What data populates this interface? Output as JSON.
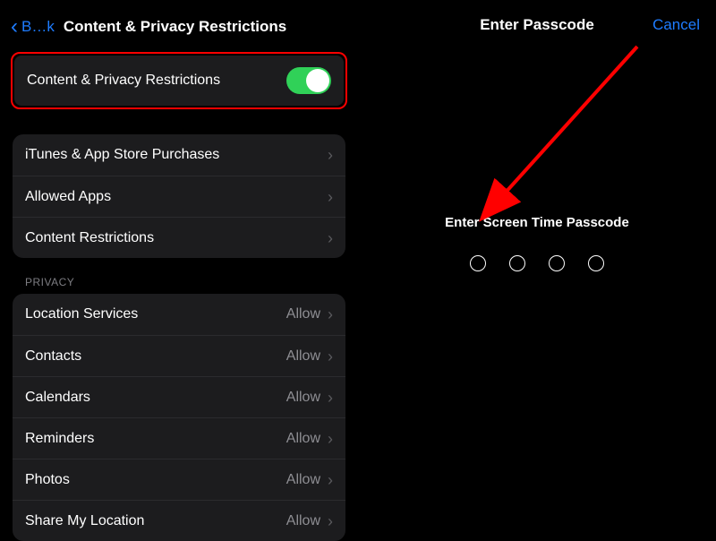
{
  "left": {
    "back_text": "B…k",
    "title": "Content & Privacy Restrictions",
    "toggle_row": {
      "label": "Content & Privacy Restrictions",
      "on": true
    },
    "nav_group": [
      {
        "label": "iTunes & App Store Purchases"
      },
      {
        "label": "Allowed Apps"
      },
      {
        "label": "Content Restrictions"
      }
    ],
    "privacy_header": "Privacy",
    "privacy_group": [
      {
        "label": "Location Services",
        "value": "Allow"
      },
      {
        "label": "Contacts",
        "value": "Allow"
      },
      {
        "label": "Calendars",
        "value": "Allow"
      },
      {
        "label": "Reminders",
        "value": "Allow"
      },
      {
        "label": "Photos",
        "value": "Allow"
      },
      {
        "label": "Share My Location",
        "value": "Allow"
      }
    ]
  },
  "right": {
    "title": "Enter Passcode",
    "cancel": "Cancel",
    "prompt": "Enter Screen Time Passcode",
    "digits": 4
  },
  "colors": {
    "accent_blue": "#1e7cff",
    "toggle_green": "#30d158",
    "annotation_red": "#ff0000"
  }
}
